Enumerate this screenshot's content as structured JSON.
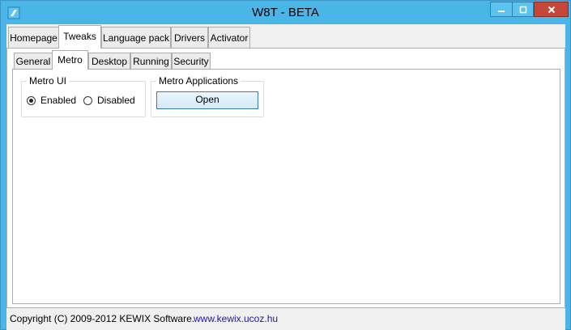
{
  "window": {
    "title": "W8T - BETA",
    "colors": {
      "frame": "#4ab6e8",
      "close": "#c7463a"
    }
  },
  "main_tabs": [
    {
      "label": "Homepage",
      "active": false
    },
    {
      "label": "Tweaks",
      "active": true
    },
    {
      "label": "Language pack",
      "active": false
    },
    {
      "label": "Drivers",
      "active": false
    },
    {
      "label": "Activator",
      "active": false
    }
  ],
  "sub_tabs": [
    {
      "label": "General",
      "active": false
    },
    {
      "label": "Metro",
      "active": true
    },
    {
      "label": "Desktop",
      "active": false
    },
    {
      "label": "Running",
      "active": false
    },
    {
      "label": "Security",
      "active": false
    }
  ],
  "metro_ui": {
    "group_label": "Metro UI",
    "options": [
      {
        "label": "Enabled",
        "checked": true
      },
      {
        "label": "Disabled",
        "checked": false
      }
    ]
  },
  "metro_apps": {
    "group_label": "Metro Applications",
    "button_label": "Open"
  },
  "footer": {
    "copyright": "Copyright (C) 2009-2012 KEWIX Software.",
    "link": "www.kewix.ucoz.hu"
  }
}
